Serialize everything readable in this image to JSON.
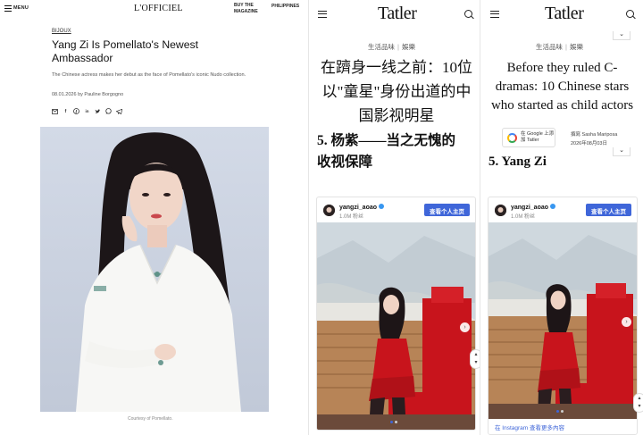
{
  "panel1": {
    "menu_label": "MENU",
    "logo": "L'OFFICIEL",
    "buy_magazine": "BUY THE MAGAZINE",
    "region": "PHILIPPINES",
    "category": "BIJOUX",
    "title": "Yang Zi Is Pomellato's Newest Ambassador",
    "dek": "The Chinese actress makes her debut as the face of Pomellato's iconic Nudo collection.",
    "date": "08.01.2026",
    "byline_prefix": "by",
    "author": "Pauline Borgogno",
    "share_icons": [
      "mail-icon",
      "facebook-icon",
      "pinterest-icon",
      "linkedin-icon",
      "twitter-icon",
      "whatsapp-icon",
      "telegram-icon"
    ],
    "photo_caption": "Courtesy of Pomellato."
  },
  "panel2": {
    "logo": "Tatler",
    "kicker_left": "生活品味",
    "kicker_sep": "|",
    "kicker_right": "娛樂",
    "headline": "在躋身一线之前：10位以\"童星\"身份出道的中国影视明星",
    "section": "5. 杨紫——当之无愧的收视保障",
    "ig_handle": "yangzi_aoao",
    "ig_followers": "1.0M 粉丝",
    "ig_button": "查看个人主页"
  },
  "panel3": {
    "logo": "Tatler",
    "kicker_left": "生活品味",
    "kicker_sep": "|",
    "kicker_right": "娛樂",
    "headline": "Before they ruled C-dramas: 10 Chinese stars who started as child actors",
    "google_chip": "在 Google 上添加 Tatler",
    "author": "撰寫 Sasha Mariposa",
    "date": "2026年08月03日",
    "section": "5. Yang Zi",
    "ig_handle": "yangzi_aoao",
    "ig_followers": "1.0M 粉丝",
    "ig_button": "查看个人主页",
    "ig_footer": "在 Instagram 查看更多內容"
  },
  "colors": {
    "instagram_blue": "#3f66d9",
    "ig_verified": "#3897f0",
    "photo1_bg": "#ccd4e2",
    "dress_red": "#c8141c"
  }
}
